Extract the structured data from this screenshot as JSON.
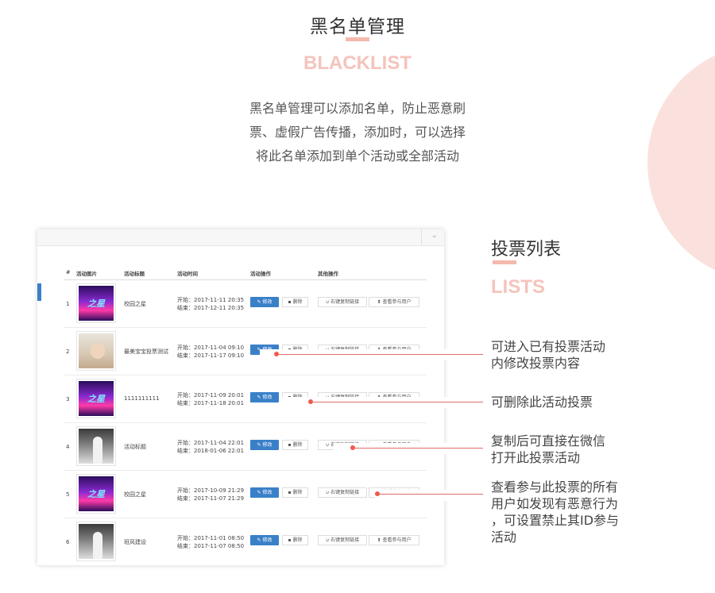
{
  "header": {
    "title": "黑名单管理",
    "subtitle": "BLACKLIST",
    "description": [
      "黑名单管理可以添加名单，防止恶意刷",
      "票、虚假广告传播，添加时，可以选择",
      "将此名单添加到单个活动或全部活动"
    ]
  },
  "section": {
    "title": "投票列表",
    "subtitle": "LISTS"
  },
  "table": {
    "headers": [
      "#",
      "活动图片",
      "活动标题",
      "活动时间",
      "活动操作",
      "其他操作"
    ],
    "edit_label": "修改",
    "delete_label": "删除",
    "copy_label": "右键复制链接",
    "users_label": "查看参与用户",
    "rows": [
      {
        "num": "1",
        "title": "校园之星",
        "start": "开始：2017-11-11 20:35",
        "end": "结束：2017-12-11 20:35",
        "thumb_text": "之星"
      },
      {
        "num": "2",
        "title": "最美宝宝投票测试",
        "start": "开始：2017-11-04 09:10",
        "end": "结束：2017-11-17 09:10"
      },
      {
        "num": "3",
        "title": "1111111111",
        "start": "开始：2017-11-09 20:01",
        "end": "结束：2017-11-18 20:01",
        "thumb_text": "之星"
      },
      {
        "num": "4",
        "title": "活动标题",
        "start": "开始：2017-11-04 22:01",
        "end": "结束：2018-01-06 22:01"
      },
      {
        "num": "5",
        "title": "校园之星",
        "start": "开始：2017-10-09 21:29",
        "end": "结束：2017-11-07 21:29",
        "thumb_text": "之星"
      },
      {
        "num": "6",
        "title": "班风建设",
        "start": "开始：2017-11-01 08:50",
        "end": "结束：2017-11-07 08:50"
      }
    ]
  },
  "annotations": [
    [
      "可进入已有投票活动",
      "内修改投票内容"
    ],
    [
      "可删除此活动投票"
    ],
    [
      "复制后可直接在微信",
      "打开此投票活动"
    ],
    [
      "查看参与此投票的所有",
      "用户如发现有恶意行为",
      "，可设置禁止其ID参与",
      "活动"
    ]
  ],
  "colors": {
    "accent": "#f5b9ae",
    "primary_button": "#3a80c8",
    "pointer": "#ef5a4e"
  },
  "icons": [
    "pencil-icon",
    "trash-icon",
    "magnet-icon",
    "upload-icon",
    "chevron-down-icon"
  ]
}
